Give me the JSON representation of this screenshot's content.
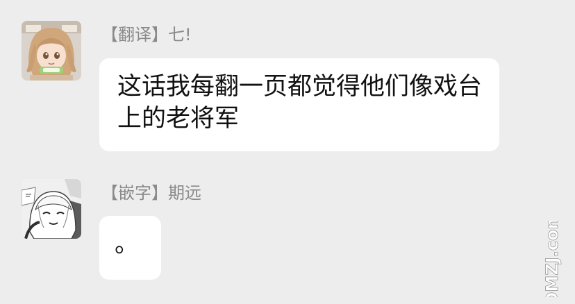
{
  "messages": [
    {
      "sender": "【翻译】七!",
      "text": "这话我每翻一页都觉得他们像戏台上的老将军",
      "avatar_icon": "anime-girl-avatar-icon"
    },
    {
      "sender": "【嵌字】期远",
      "text": "。",
      "avatar_icon": "manga-girl-avatar-icon"
    }
  ],
  "watermark": {
    "text": "DMZJ.com"
  },
  "colors": {
    "background": "#ededed",
    "bubble": "#ffffff",
    "sender_text": "#8a8a8a",
    "message_text": "#111111"
  }
}
